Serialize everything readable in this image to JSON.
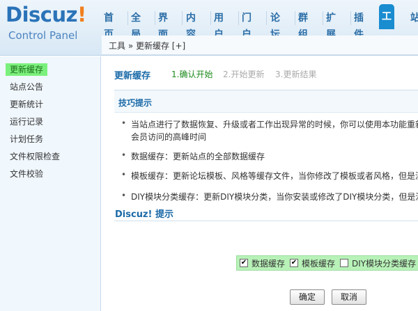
{
  "logo": {
    "title": "Discuz",
    "bang": "!",
    "subtitle": "Control Panel"
  },
  "nav": [
    "首页",
    "全局",
    "界面",
    "内容",
    "用户",
    "门户",
    "论坛",
    "群组",
    "扩展",
    "插件",
    "工具",
    "站"
  ],
  "nav_active": "工具",
  "breadcrumb": "工具 » 更新缓存 [+]",
  "sidebar": [
    "更新缓存",
    "站点公告",
    "更新统计",
    "运行记录",
    "计划任务",
    "文件权限检查",
    "文件校验"
  ],
  "main": {
    "title": "更新缓存",
    "steps": [
      "1.确认开始",
      "2.开始更新",
      "3.更新结果"
    ]
  },
  "tips": {
    "title": "技巧提示",
    "items": [
      "当站点进行了数据恢复、升级或者工作出现异常的时候，你可以使用本功能重新",
      "会员访问的高峰时间",
      "数据缓存：更新站点的全部数据缓存",
      "模板缓存：更新论坛模板、风格等缓存文件，当你修改了模板或者风格，但是没",
      "DIY模块分类缓存：更新DIY模块分类，当你安装或修改了DIY模块分类，但是没"
    ]
  },
  "discuz_tip": {
    "title": "Discuz! 提示"
  },
  "options": [
    {
      "label": "数据缓存",
      "checked": true
    },
    {
      "label": "模板缓存",
      "checked": true
    },
    {
      "label": "DIY模块分类缓存",
      "checked": false
    }
  ],
  "buttons": {
    "confirm": "确定",
    "cancel": "取消"
  }
}
